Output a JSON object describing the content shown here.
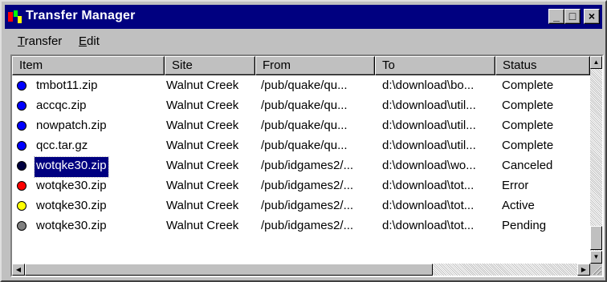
{
  "window": {
    "title": "Transfer Manager",
    "controls": {
      "minimize": "_",
      "maximize": "□",
      "close": "×"
    }
  },
  "menu": [
    {
      "label_first": "T",
      "label_rest": "ransfer"
    },
    {
      "label_first": "E",
      "label_rest": "dit"
    }
  ],
  "columns": [
    "Item",
    "Site",
    "From",
    "To",
    "Status"
  ],
  "rows": [
    {
      "item": "tmbot11.zip",
      "site": "Walnut Creek",
      "from": "/pub/quake/qu...",
      "to": "d:\\download\\bo...",
      "status": "Complete",
      "dot_color": "#0000ff",
      "selected": false
    },
    {
      "item": "accqc.zip",
      "site": "Walnut Creek",
      "from": "/pub/quake/qu...",
      "to": "d:\\download\\util...",
      "status": "Complete",
      "dot_color": "#0000ff",
      "selected": false
    },
    {
      "item": "nowpatch.zip",
      "site": "Walnut Creek",
      "from": "/pub/quake/qu...",
      "to": "d:\\download\\util...",
      "status": "Complete",
      "dot_color": "#0000ff",
      "selected": false
    },
    {
      "item": "qcc.tar.gz",
      "site": "Walnut Creek",
      "from": "/pub/quake/qu...",
      "to": "d:\\download\\util...",
      "status": "Complete",
      "dot_color": "#0000ff",
      "selected": false
    },
    {
      "item": "wotqke30.zip",
      "site": "Walnut Creek",
      "from": "/pub/idgames2/...",
      "to": "d:\\download\\wo...",
      "status": "Canceled",
      "dot_color": "#000040",
      "selected": true
    },
    {
      "item": "wotqke30.zip",
      "site": "Walnut Creek",
      "from": "/pub/idgames2/...",
      "to": "d:\\download\\tot...",
      "status": "Error",
      "dot_color": "#ff0000",
      "selected": false
    },
    {
      "item": "wotqke30.zip",
      "site": "Walnut Creek",
      "from": "/pub/idgames2/...",
      "to": "d:\\download\\tot...",
      "status": "Active",
      "dot_color": "#ffff00",
      "selected": false
    },
    {
      "item": "wotqke30.zip",
      "site": "Walnut Creek",
      "from": "/pub/idgames2/...",
      "to": "d:\\download\\tot...",
      "status": "Pending",
      "dot_color": "#808080",
      "selected": false
    }
  ],
  "icons": {
    "app": "transfer-manager-icon",
    "scroll_up": "arrow-up-icon",
    "scroll_down": "arrow-down-icon",
    "scroll_left": "arrow-left-icon",
    "scroll_right": "arrow-right-icon"
  }
}
